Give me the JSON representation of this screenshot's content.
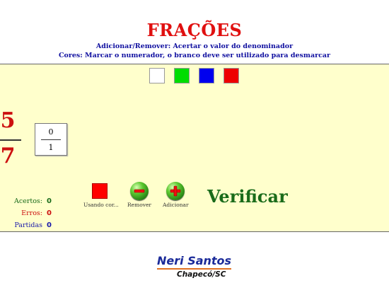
{
  "header": {
    "title": "FRAÇÕES",
    "instruction_1": "Adicionar/Remover: Acertar o valor do denominador",
    "instruction_2": "Cores: Marcar o numerador, o branco deve ser utilizado para desmarcar"
  },
  "palette": {
    "colors": [
      {
        "name": "white",
        "hex": "#ffffff"
      },
      {
        "name": "green",
        "hex": "#00dd00"
      },
      {
        "name": "blue",
        "hex": "#0000ee"
      },
      {
        "name": "red",
        "hex": "#ee0000"
      }
    ]
  },
  "target_fraction": {
    "numerator": "5",
    "denominator": "7"
  },
  "answer_fraction": {
    "numerator": "0",
    "denominator": "1"
  },
  "stats": {
    "hits_label": "Acertos:",
    "hits_value": "0",
    "hits_color": "#1a6b1a",
    "errors_label": "Erros:",
    "errors_value": "0",
    "errors_color": "#cc1010",
    "games_label": "Partidas",
    "games_value": "0",
    "games_color": "#1a1aaa"
  },
  "controls": {
    "using_color_label": "Usando cor...",
    "using_color_hex": "#ff0000",
    "remove_label": "Remover",
    "add_label": "Adicionar",
    "verify_label": "Verificar"
  },
  "footer": {
    "author": "Neri Santos",
    "city": "Chapecó/SC"
  }
}
